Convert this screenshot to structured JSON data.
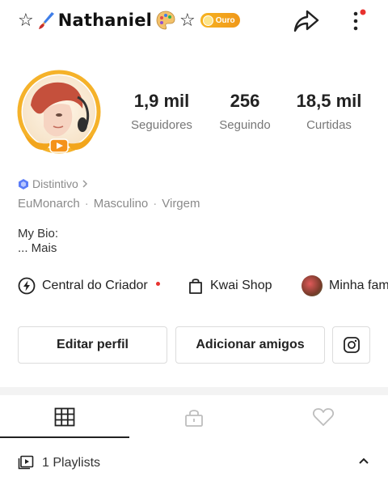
{
  "header": {
    "star_left": "☆",
    "name": "Nathaniel",
    "star_right": "☆",
    "level_badge": "Ouro",
    "share_icon": "share-arrow-icon",
    "more_icon": "more-vertical-icon",
    "notification_color": "#e8322f"
  },
  "stats": [
    {
      "value": "1,9 mil",
      "label": "Seguidores"
    },
    {
      "value": "256",
      "label": "Seguindo"
    },
    {
      "value": "18,5 mil",
      "label": "Curtidas"
    }
  ],
  "profile": {
    "badge_label": "Distintivo",
    "username": "EuMonarch",
    "gender": "Masculino",
    "sign": "Virgem",
    "bio_title": "My Bio:",
    "bio_more": "...  Mais"
  },
  "links": [
    {
      "label": "Central do Criador",
      "icon": "bolt-icon"
    },
    {
      "label": "Kwai Shop",
      "icon": "shopping-bag-icon"
    },
    {
      "label": "Minha fam",
      "icon": "family-avatar"
    }
  ],
  "buttons": {
    "edit_profile": "Editar perfil",
    "add_friends": "Adicionar amigos",
    "instagram_icon": "instagram-icon"
  },
  "tabs": [
    {
      "name": "posts",
      "icon": "grid-icon",
      "active": true
    },
    {
      "name": "private",
      "icon": "lock-icon",
      "active": false
    },
    {
      "name": "liked",
      "icon": "heart-icon",
      "active": false
    }
  ],
  "playlists": {
    "label": "1 Playlists"
  },
  "colors": {
    "accent_gold": "#f6b320",
    "text_primary": "#222222",
    "text_secondary": "#8a8a8a",
    "badge_blue": "#5b7cf7"
  }
}
